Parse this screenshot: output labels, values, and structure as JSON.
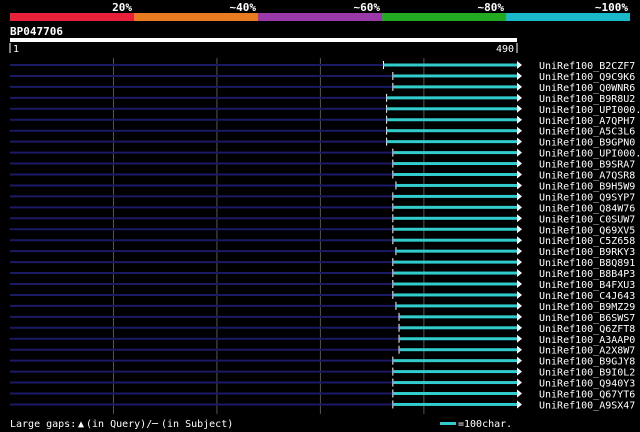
{
  "identity_scale": {
    "labels": [
      "20%",
      "~40%",
      "~60%",
      "~80%",
      "~100%"
    ],
    "colors": [
      "#e8203a",
      "#e87a20",
      "#9a3aa8",
      "#22aa22",
      "#1ab8c8"
    ]
  },
  "query": {
    "id": "BP047706",
    "start_label": "1",
    "end_label": "490"
  },
  "legend": {
    "gaps_prefix": "Large gaps:",
    "gaps_query_marker": "▲",
    "gaps_query_text": "(in Query)/",
    "gaps_subject_marker": "─",
    "gaps_subject_text": "(in Subject)",
    "scale_text": "=100char."
  },
  "colors": {
    "background": "#000000",
    "hit_line": "#33cccc",
    "gap_line": "#1a1a66",
    "grid": "#555555",
    "text": "#ffffff"
  },
  "chart_data": {
    "type": "alignment-hits",
    "query_length": 490,
    "grid_ticks": [
      100,
      200,
      300,
      400
    ],
    "hits": [
      {
        "name": "UniRef100_B2CZF7",
        "start": 361,
        "end": 490,
        "color": "#33cccc"
      },
      {
        "name": "UniRef100_Q9C9K6",
        "start": 370,
        "end": 490,
        "color": "#33cccc"
      },
      {
        "name": "UniRef100_Q0WNR6",
        "start": 370,
        "end": 490,
        "color": "#33cccc"
      },
      {
        "name": "UniRef100_B9R8U2",
        "start": 364,
        "end": 490,
        "color": "#33cccc"
      },
      {
        "name": "UniRef100_UPI000..",
        "start": 364,
        "end": 490,
        "color": "#33cccc"
      },
      {
        "name": "UniRef100_A7QPH7",
        "start": 364,
        "end": 490,
        "color": "#33cccc"
      },
      {
        "name": "UniRef100_A5C3L6",
        "start": 364,
        "end": 490,
        "color": "#33cccc"
      },
      {
        "name": "UniRef100_B9GPN0",
        "start": 364,
        "end": 490,
        "color": "#33cccc"
      },
      {
        "name": "UniRef100_UPI000..",
        "start": 370,
        "end": 490,
        "color": "#33cccc"
      },
      {
        "name": "UniRef100_B9SRA7",
        "start": 370,
        "end": 490,
        "color": "#33cccc"
      },
      {
        "name": "UniRef100_A7QSR8",
        "start": 370,
        "end": 490,
        "color": "#33cccc"
      },
      {
        "name": "UniRef100_B9H5W9",
        "start": 373,
        "end": 490,
        "color": "#33cccc"
      },
      {
        "name": "UniRef100_Q9SYP7",
        "start": 370,
        "end": 490,
        "color": "#33cccc"
      },
      {
        "name": "UniRef100_Q84W76",
        "start": 370,
        "end": 490,
        "color": "#33cccc"
      },
      {
        "name": "UniRef100_C0SUW7",
        "start": 370,
        "end": 490,
        "color": "#33cccc"
      },
      {
        "name": "UniRef100_Q69XV5",
        "start": 370,
        "end": 490,
        "color": "#33cccc"
      },
      {
        "name": "UniRef100_C5Z658",
        "start": 370,
        "end": 490,
        "color": "#33cccc"
      },
      {
        "name": "UniRef100_B9RKY3",
        "start": 373,
        "end": 490,
        "color": "#33cccc"
      },
      {
        "name": "UniRef100_B8Q891",
        "start": 370,
        "end": 490,
        "color": "#33cccc"
      },
      {
        "name": "UniRef100_B8B4P3",
        "start": 370,
        "end": 490,
        "color": "#33cccc"
      },
      {
        "name": "UniRef100_B4FXU3",
        "start": 370,
        "end": 490,
        "color": "#33cccc"
      },
      {
        "name": "UniRef100_C4J643",
        "start": 370,
        "end": 490,
        "color": "#33cccc"
      },
      {
        "name": "UniRef100_B9MZ29",
        "start": 373,
        "end": 490,
        "color": "#33cccc"
      },
      {
        "name": "UniRef100_B6SWS7",
        "start": 376,
        "end": 490,
        "color": "#33cccc"
      },
      {
        "name": "UniRef100_Q6ZFT8",
        "start": 376,
        "end": 490,
        "color": "#33cccc"
      },
      {
        "name": "UniRef100_A3AAP0",
        "start": 376,
        "end": 490,
        "color": "#33cccc"
      },
      {
        "name": "UniRef100_A2X8W7",
        "start": 376,
        "end": 490,
        "color": "#33cccc"
      },
      {
        "name": "UniRef100_B9GJY8",
        "start": 370,
        "end": 490,
        "color": "#33cccc"
      },
      {
        "name": "UniRef100_B9I0L2",
        "start": 370,
        "end": 490,
        "color": "#33cccc"
      },
      {
        "name": "UniRef100_Q940Y3",
        "start": 370,
        "end": 490,
        "color": "#33cccc"
      },
      {
        "name": "UniRef100_Q67YT6",
        "start": 370,
        "end": 490,
        "color": "#33cccc"
      },
      {
        "name": "UniRef100_A9SX47",
        "start": 370,
        "end": 490,
        "color": "#33cccc"
      }
    ]
  }
}
